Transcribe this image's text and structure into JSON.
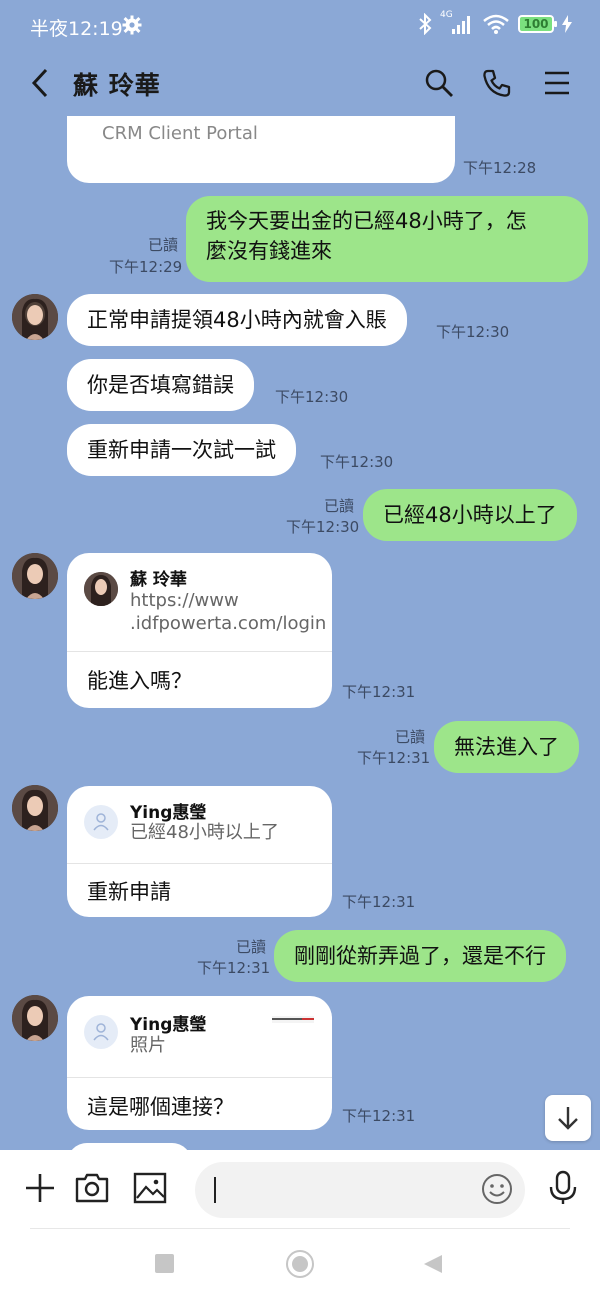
{
  "status": {
    "time": "半夜12:19",
    "network": "4G",
    "battery": "100"
  },
  "header": {
    "title": "蘇 玲華"
  },
  "messages": {
    "m0_card_text": "CRM Client Portal",
    "m0_time": "下午12:28",
    "m1_line1": "我今天要出金的已經48小時了，怎",
    "m1_line2": "麼沒有錢進來",
    "m1_read": "已讀",
    "m1_time": "下午12:29",
    "m2": "正常申請提領48小時內就會入賬",
    "m2_time": "下午12:30",
    "m3": "你是否填寫錯誤",
    "m3_time": "下午12:30",
    "m4": "重新申請一次試一試",
    "m4_time": "下午12:30",
    "m5": "已經48小時以上了",
    "m5_read": "已讀",
    "m5_time": "下午12:30",
    "m6_title": "蘇 玲華",
    "m6_link1": "https://www",
    "m6_link2": ".idfpowerta.com/login",
    "m6_body": "能進入嗎？",
    "m6_time": "下午12:31",
    "m7": "無法進入了",
    "m7_read": "已讀",
    "m7_time": "下午12:31",
    "m8_title": "Ying惠瑩",
    "m8_quote": "已經48小時以上了",
    "m8_body": "重新申請",
    "m8_time": "下午12:31",
    "m9": "剛剛從新弄過了，還是不行",
    "m9_read": "已讀",
    "m9_time": "下午12:31",
    "m10_title": "Ying惠瑩",
    "m10_quote": "照片",
    "m10_body": "這是哪個連接？",
    "m10_time": "下午12:31"
  },
  "input": {
    "placeholder": ""
  },
  "colors": {
    "chat_bg": "#8ba8d6",
    "outgoing_bubble": "#9de58a",
    "incoming_bubble": "#ffffff",
    "battery": "#7be07f"
  },
  "icons": [
    "back-icon",
    "search-icon",
    "phone-icon",
    "menu-icon",
    "plus-icon",
    "camera-icon",
    "image-icon",
    "emoji-icon",
    "mic-icon",
    "arrow-down-icon"
  ]
}
